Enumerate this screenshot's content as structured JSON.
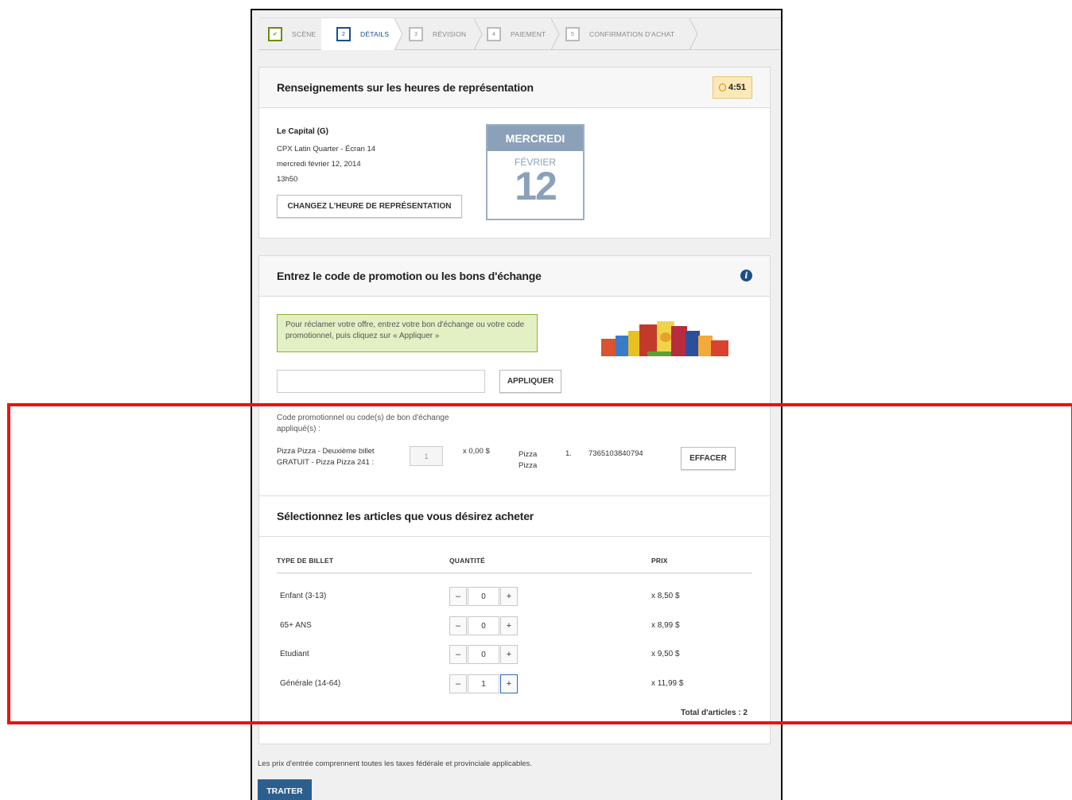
{
  "steps": [
    {
      "num": "✔",
      "label": "SCÈNE",
      "state": "done"
    },
    {
      "num": "2",
      "label": "DÉTAILS",
      "state": "active"
    },
    {
      "num": "3",
      "label": "RÉVISION",
      "state": "pending"
    },
    {
      "num": "4",
      "label": "PAIEMENT",
      "state": "pending"
    },
    {
      "num": "5",
      "label": "CONFIRMATION D'ACHAT",
      "state": "pending"
    }
  ],
  "showtime": {
    "heading": "Renseignements sur les heures de représentation",
    "timer": "4:51",
    "movie": "Le Capital (G)",
    "theatre": "CPX Latin Quarter - Écran 14",
    "date": "mercredi février 12, 2014",
    "time": "13h50",
    "change_button": "CHANGEZ L'HEURE DE REPRÉSENTATION",
    "calendar": {
      "day": "MERCREDI",
      "month": "FÉVRIER",
      "number": "12"
    }
  },
  "promo": {
    "heading": "Entrez le code de promotion ou les bons d'échange",
    "note": "Pour réclamer votre offre, entrez votre bon d'échange ou votre code promotionnel, puis cliquez sur « Appliquer »",
    "input_value": "",
    "apply_button": "APPLIQUER",
    "applied_label": "Code promotionnel ou code(s) de bon d'échange appliqué(s) :",
    "applied": {
      "name": "Pizza Pizza - Deuxième billet GRATUIT - Pizza Pizza 241 :",
      "qty": "1",
      "price": "x 0,00 $",
      "vendor": "Pizza Pizza",
      "index": "1.",
      "code": "7365103840794",
      "clear_button": "EFFACER"
    }
  },
  "tickets": {
    "heading": "Sélectionnez les articles que vous désirez acheter",
    "col_type": "TYPE DE BILLET",
    "col_qty": "QUANTITÉ",
    "col_price": "PRIX",
    "rows": [
      {
        "label": "Enfant (3-13)",
        "qty": "0",
        "price": "x 8,50 $"
      },
      {
        "label": "65+ ANS",
        "qty": "0",
        "price": "x 8,99 $"
      },
      {
        "label": "Etudiant",
        "qty": "0",
        "price": "x 9,50 $"
      },
      {
        "label": "Générale (14-64)",
        "qty": "1",
        "price": "x 11,99 $"
      }
    ],
    "minus": "–",
    "plus": "+",
    "total": "Total d'articles : 2"
  },
  "footer": {
    "note": "Les prix d'entrée comprennent toutes les taxes fédérale et provinciale applicables.",
    "submit_button": "TRAITER"
  },
  "colors": {
    "accent": "#1b4f88",
    "done": "#6d8a12",
    "highlight": "#ee1111",
    "timer_bg": "#fde9b8"
  }
}
